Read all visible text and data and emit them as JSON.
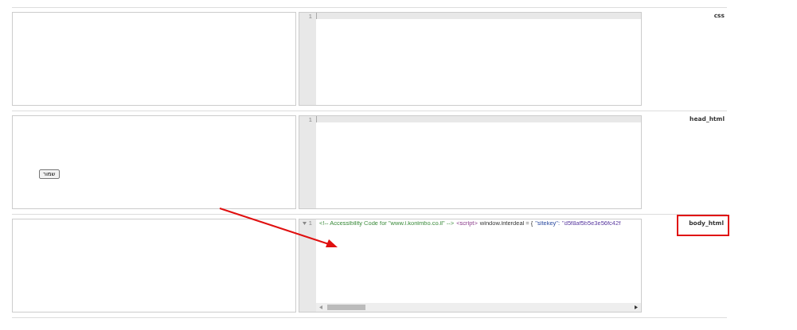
{
  "rows": [
    {
      "label": "css",
      "highlighted": false,
      "line_number": "1",
      "foldable": false,
      "code": []
    },
    {
      "label": "head_html",
      "highlighted": false,
      "line_number": "1",
      "foldable": false,
      "button": "שמור",
      "code": []
    },
    {
      "label": "body_html",
      "highlighted": true,
      "line_number": "1",
      "foldable": true,
      "code": [
        {
          "kind": "comment",
          "text": "<!-- Accessibility Code for \"www.i.konimbo.co.il\" -->"
        },
        {
          "kind": "tag",
          "text": "<script>"
        },
        {
          "kind": "plain",
          "text": "window.interdeal = {"
        },
        {
          "kind": "string",
          "text": "\"sitekey\":"
        },
        {
          "kind": "value",
          "text": "\"d5f8af5b5e3e56fc42f"
        }
      ]
    }
  ]
}
